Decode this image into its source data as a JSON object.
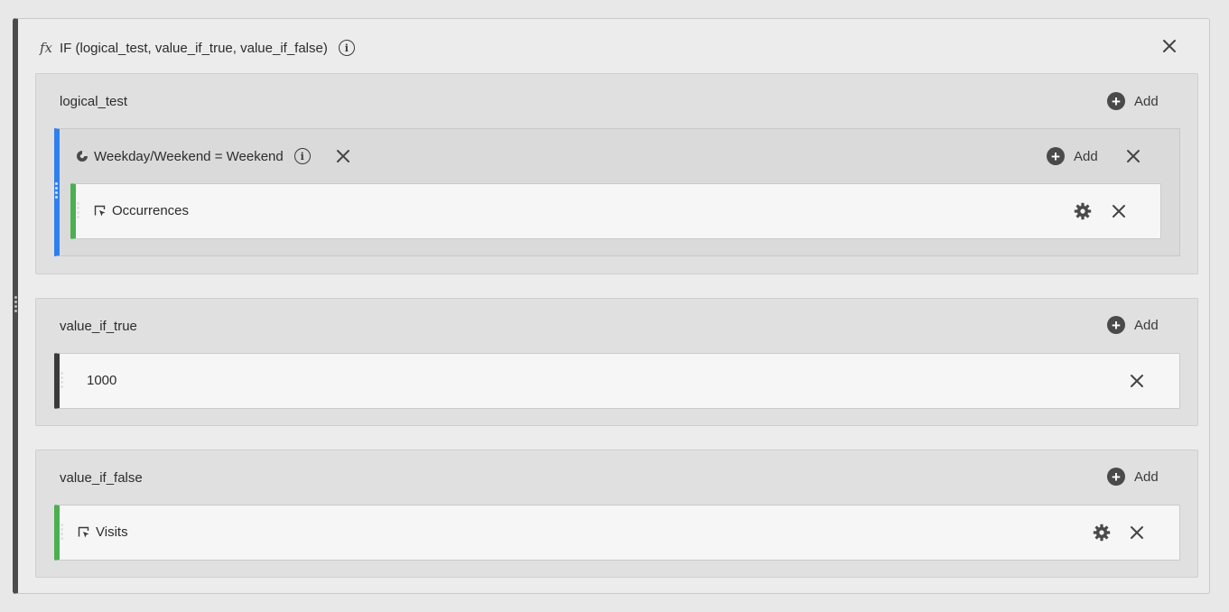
{
  "function": {
    "fx_symbol": "fx",
    "signature": "IF (logical_test, value_if_true, value_if_false)"
  },
  "args": {
    "logical_test": {
      "label": "logical_test",
      "add_label": "Add",
      "segment": {
        "label": "Weekday/Weekend = Weekend",
        "add_label": "Add",
        "metric": {
          "label": "Occurrences"
        }
      }
    },
    "value_if_true": {
      "label": "value_if_true",
      "add_label": "Add",
      "static_value": "1000"
    },
    "value_if_false": {
      "label": "value_if_false",
      "add_label": "Add",
      "metric": {
        "label": "Visits"
      }
    }
  },
  "colors": {
    "segment_accent": "#2f80ed",
    "metric_accent": "#4caf50",
    "static_accent": "#3a3a3a"
  }
}
